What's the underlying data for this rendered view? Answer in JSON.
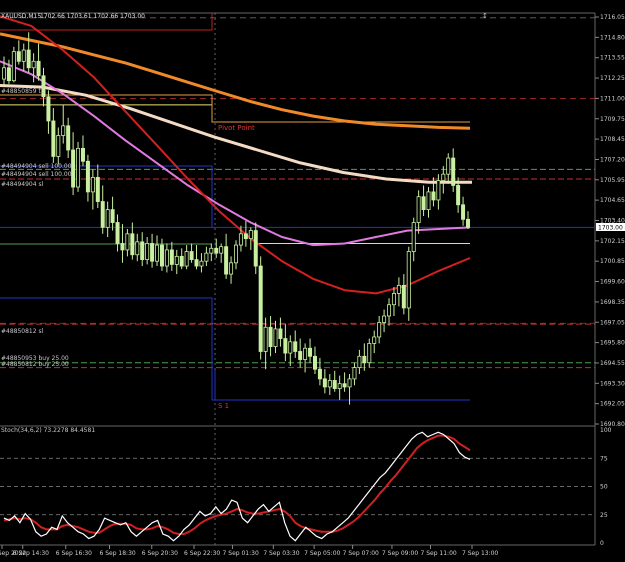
{
  "window": {
    "title": "XAUUSD,M15",
    "ohlc": "1702.66 1703.61 1702.66 1703.00"
  },
  "colors": {
    "background": "#000000",
    "candle": "#c8f0a0",
    "grid": "#3a3a3a",
    "ma_orange": "#f08a28",
    "ma_cream": "#f4dcc4",
    "ma_violet": "#e07ae0",
    "ma_red": "#d42020",
    "stoch_main": "#ffffff",
    "stoch_signal": "#d02020",
    "level_yellow": "#e8e070",
    "level_blue": "#2233cc",
    "level_red_dash": "#c03030",
    "level_green_dash": "#50a050"
  },
  "price_axis": {
    "labels": [
      "1716.05",
      "1714.80",
      "1713.55",
      "1712.25",
      "1711.00",
      "1709.75",
      "1708.45",
      "1707.20",
      "1705.95",
      "1704.65",
      "1703.40",
      "1702.15",
      "1700.85",
      "1699.60",
      "1698.35",
      "1697.05",
      "1695.80",
      "1694.55",
      "1693.30",
      "1692.05",
      "1690.80"
    ],
    "current_price": "1703.00"
  },
  "time_axis": {
    "labels": [
      "6 Sep 2022",
      "6 Sep 14:30",
      "6 Sep 16:30",
      "6 Sep 18:30",
      "6 Sep 20:30",
      "6 Sep 22:30",
      "7 Sep 01:30",
      "7 Sep 03:30",
      "7 Sep 05:00",
      "7 Sep 07:00",
      "7 Sep 09:00",
      "7 Sep 11:00",
      "7 Sep 13:00"
    ]
  },
  "annotations": {
    "tp_label": "#48850859 tp",
    "sell_label_1": "#48494904 sell 100.00",
    "sell_label_2": "#48494904 sell 100.00",
    "sell_label_3": "#48494904 sl",
    "sl_label": "#48850812 sl",
    "buy_label_1": "#48850953 buy 25.00",
    "buy_label_2": "#48850812 buy 25.00",
    "pivot_label": "Pivot Point",
    "s1_label": "S 1"
  },
  "stochastic": {
    "label": "Stoch(34,6,2) 73.2278 84.4581",
    "levels": [
      "100",
      "75",
      "50",
      "25",
      "0"
    ]
  },
  "chart_data": {
    "type": "candlestick",
    "title": "XAUUSD,M15",
    "symbol": "XAUUSD",
    "timeframe": "M15",
    "price_range": [
      1690.8,
      1716.05
    ],
    "candles_ohlc": [
      [
        1712.2,
        1713.6,
        1711.7,
        1712.9
      ],
      [
        1712.9,
        1713.4,
        1711.9,
        1712.1
      ],
      [
        1712.1,
        1714.2,
        1712.0,
        1713.9
      ],
      [
        1713.9,
        1714.6,
        1713.1,
        1713.3
      ],
      [
        1713.3,
        1714.4,
        1712.7,
        1714.0
      ],
      [
        1714.0,
        1715.1,
        1712.6,
        1712.9
      ],
      [
        1712.9,
        1713.8,
        1712.0,
        1713.3
      ],
      [
        1713.3,
        1714.4,
        1712.1,
        1712.4
      ],
      [
        1712.4,
        1712.9,
        1710.5,
        1711.1
      ],
      [
        1711.1,
        1711.5,
        1708.8,
        1709.6
      ],
      [
        1709.6,
        1710.4,
        1707.0,
        1707.4
      ],
      [
        1707.4,
        1709.2,
        1706.9,
        1708.7
      ],
      [
        1708.7,
        1710.6,
        1708.2,
        1709.3
      ],
      [
        1709.3,
        1709.8,
        1707.3,
        1707.8
      ],
      [
        1707.8,
        1708.9,
        1705.0,
        1705.5
      ],
      [
        1705.5,
        1708.3,
        1705.2,
        1707.9
      ],
      [
        1707.9,
        1708.7,
        1706.8,
        1707.1
      ],
      [
        1707.1,
        1707.5,
        1704.6,
        1705.2
      ],
      [
        1705.2,
        1706.6,
        1704.1,
        1706.1
      ],
      [
        1706.1,
        1706.9,
        1704.2,
        1704.6
      ],
      [
        1704.6,
        1705.6,
        1702.6,
        1703.0
      ],
      [
        1703.0,
        1704.6,
        1702.4,
        1704.1
      ],
      [
        1704.1,
        1704.9,
        1702.8,
        1703.3
      ],
      [
        1703.3,
        1703.8,
        1701.5,
        1702.0
      ],
      [
        1702.0,
        1703.2,
        1700.8,
        1701.6
      ],
      [
        1701.6,
        1702.9,
        1701.2,
        1702.6
      ],
      [
        1702.6,
        1703.3,
        1701.0,
        1701.3
      ],
      [
        1701.3,
        1702.6,
        1700.9,
        1702.1
      ],
      [
        1702.1,
        1702.7,
        1700.6,
        1701.0
      ],
      [
        1701.0,
        1702.4,
        1700.7,
        1702.0
      ],
      [
        1702.0,
        1702.6,
        1700.5,
        1700.9
      ],
      [
        1700.9,
        1702.5,
        1700.6,
        1701.9
      ],
      [
        1701.9,
        1702.3,
        1700.3,
        1700.6
      ],
      [
        1700.6,
        1702.0,
        1700.2,
        1701.6
      ],
      [
        1701.6,
        1702.1,
        1700.3,
        1700.7
      ],
      [
        1700.7,
        1701.6,
        1700.1,
        1701.2
      ],
      [
        1701.2,
        1701.7,
        1700.4,
        1700.6
      ],
      [
        1700.6,
        1701.9,
        1700.4,
        1701.5
      ],
      [
        1701.5,
        1702.0,
        1700.8,
        1701.0
      ],
      [
        1701.0,
        1701.9,
        1700.4,
        1700.6
      ],
      [
        1700.6,
        1701.4,
        1700.2,
        1700.9
      ],
      [
        1700.9,
        1701.8,
        1700.6,
        1701.4
      ],
      [
        1701.4,
        1702.0,
        1700.9,
        1701.7
      ],
      [
        1701.7,
        1702.3,
        1701.1,
        1701.4
      ],
      [
        1701.4,
        1702.0,
        1700.8,
        1701.8
      ],
      [
        1701.8,
        1702.6,
        1699.8,
        1700.1
      ],
      [
        1700.1,
        1701.2,
        1699.5,
        1700.8
      ],
      [
        1700.8,
        1702.2,
        1700.4,
        1701.9
      ],
      [
        1701.9,
        1703.1,
        1701.5,
        1702.6
      ],
      [
        1702.6,
        1703.4,
        1701.8,
        1702.3
      ],
      [
        1702.3,
        1703.0,
        1701.6,
        1702.8
      ],
      [
        1702.8,
        1703.3,
        1700.1,
        1700.6
      ],
      [
        1700.6,
        1701.2,
        1694.8,
        1695.3
      ],
      [
        1695.3,
        1697.4,
        1694.2,
        1696.8
      ],
      [
        1696.8,
        1697.5,
        1695.0,
        1695.6
      ],
      [
        1695.6,
        1697.2,
        1695.2,
        1696.7
      ],
      [
        1696.7,
        1697.4,
        1695.6,
        1696.1
      ],
      [
        1696.1,
        1697.0,
        1694.7,
        1695.2
      ],
      [
        1695.2,
        1696.3,
        1694.4,
        1695.9
      ],
      [
        1695.9,
        1696.6,
        1694.9,
        1695.3
      ],
      [
        1695.3,
        1696.1,
        1694.3,
        1694.8
      ],
      [
        1694.8,
        1695.8,
        1694.0,
        1695.5
      ],
      [
        1695.5,
        1696.1,
        1694.6,
        1695.0
      ],
      [
        1695.0,
        1695.6,
        1693.9,
        1694.2
      ],
      [
        1694.2,
        1694.9,
        1693.2,
        1693.6
      ],
      [
        1693.6,
        1694.2,
        1692.7,
        1693.1
      ],
      [
        1693.1,
        1693.9,
        1692.6,
        1693.5
      ],
      [
        1693.5,
        1694.1,
        1692.8,
        1693.0
      ],
      [
        1693.0,
        1693.8,
        1692.3,
        1693.3
      ],
      [
        1693.3,
        1694.0,
        1692.8,
        1693.1
      ],
      [
        1693.1,
        1693.9,
        1692.0,
        1693.6
      ],
      [
        1693.6,
        1694.6,
        1693.2,
        1694.3
      ],
      [
        1694.3,
        1695.4,
        1693.9,
        1695.0
      ],
      [
        1695.0,
        1695.8,
        1694.1,
        1694.6
      ],
      [
        1694.6,
        1696.1,
        1694.3,
        1695.8
      ],
      [
        1695.8,
        1696.6,
        1695.2,
        1696.2
      ],
      [
        1696.2,
        1697.5,
        1695.8,
        1697.1
      ],
      [
        1697.1,
        1697.9,
        1696.5,
        1697.5
      ],
      [
        1697.5,
        1698.6,
        1696.9,
        1698.2
      ],
      [
        1698.2,
        1699.3,
        1697.5,
        1698.9
      ],
      [
        1698.9,
        1699.9,
        1698.1,
        1699.4
      ],
      [
        1699.4,
        1700.1,
        1697.6,
        1698.0
      ],
      [
        1698.0,
        1701.8,
        1697.2,
        1701.5
      ],
      [
        1701.5,
        1703.6,
        1700.9,
        1703.3
      ],
      [
        1703.3,
        1705.3,
        1702.6,
        1704.9
      ],
      [
        1704.9,
        1705.6,
        1703.7,
        1704.1
      ],
      [
        1704.1,
        1705.5,
        1703.6,
        1705.2
      ],
      [
        1705.2,
        1706.1,
        1704.3,
        1704.7
      ],
      [
        1704.7,
        1706.3,
        1704.1,
        1705.9
      ],
      [
        1705.9,
        1706.8,
        1705.1,
        1706.3
      ],
      [
        1706.3,
        1707.6,
        1705.7,
        1707.3
      ],
      [
        1707.3,
        1707.9,
        1705.2,
        1705.6
      ],
      [
        1705.6,
        1706.1,
        1703.9,
        1704.4
      ],
      [
        1704.4,
        1704.9,
        1703.1,
        1703.5
      ],
      [
        1703.5,
        1704.0,
        1702.9,
        1703.0
      ]
    ],
    "levels": [
      {
        "name": "tp",
        "price": 1710.6,
        "style": "solid",
        "color": "yellow"
      },
      {
        "name": "sell",
        "price": 1706.6,
        "style": "dash",
        "color": "green"
      },
      {
        "name": "sell",
        "price": 1706.0,
        "style": "dash",
        "color": "red"
      },
      {
        "name": "sl",
        "price": 1697.0,
        "style": "dash",
        "color": "red"
      },
      {
        "name": "buy",
        "price": 1694.6,
        "style": "dash",
        "color": "green"
      },
      {
        "name": "buy",
        "price": 1694.3,
        "style": "dash",
        "color": "red"
      },
      {
        "name": "pivot",
        "price": 1702.0,
        "style": "solid",
        "color": "yellow"
      },
      {
        "name": "current",
        "price": 1703.0,
        "style": "solid",
        "color": "blue"
      }
    ],
    "stoch_range": [
      0,
      100
    ]
  }
}
